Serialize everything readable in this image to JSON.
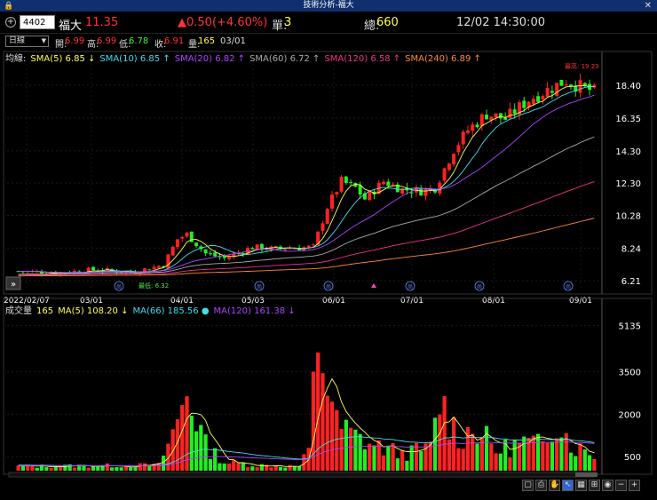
{
  "window": {
    "title": "技術分析-福大"
  },
  "header": {
    "code": "4402",
    "name": "福大",
    "price": "11.35",
    "change": "▲0.50(+4.60%)",
    "unit_label": "單:",
    "unit_value": "3",
    "total_label": "總:",
    "total_value": "660",
    "datetime": "12/02 14:30:00"
  },
  "status": {
    "period": "日線",
    "open_label": "開:",
    "open": "6.99",
    "high_label": "高:",
    "high": "6.99",
    "low_label": "低:",
    "low": "6.78",
    "close_label": "收:",
    "close": "6.91",
    "volume_label": "量:",
    "volume": "165",
    "date": "03/01"
  },
  "ma_legend": {
    "label": "均線:",
    "items": [
      {
        "text": "SMA(5) 6.85 ↓",
        "color": "#ffff55"
      },
      {
        "text": "SMA(10) 6.85 ↑",
        "color": "#44ddee"
      },
      {
        "text": "SMA(20) 6.82 ↑",
        "color": "#aa44ff"
      },
      {
        "text": "SMA(60) 6.72 ↑",
        "color": "#aaaaaa"
      },
      {
        "text": "SMA(120) 6.58 ↑",
        "color": "#ee3388"
      },
      {
        "text": "SMA(240) 6.89 ↑",
        "color": "#ff8833"
      }
    ]
  },
  "vol_legend": {
    "label": "成交量",
    "value": "165",
    "items": [
      {
        "text": "MA(5) 108.20 ↓",
        "color": "#ffff55"
      },
      {
        "text": "MA(66) 185.56 ●",
        "color": "#44ddee"
      },
      {
        "text": "MA(120) 161.38 ↓",
        "color": "#aa44ff"
      }
    ]
  },
  "colors": {
    "up": "#ff2222",
    "down": "#22ee22",
    "axis": "#ffffff"
  },
  "chart_data": [
    {
      "type": "candlestick",
      "title": "",
      "x_ticks": [
        "2022/02/07",
        "03/01",
        "04/01",
        "05/03",
        "06/01",
        "07/01",
        "08/01",
        "09/01"
      ],
      "y_ticks": [
        6.21,
        8.24,
        10.28,
        12.3,
        14.3,
        16.35,
        18.4
      ],
      "ylim": [
        5.6,
        20.0
      ],
      "annotations": [
        {
          "text": "最高: 19.23"
        },
        {
          "text": "最低: 6.32"
        }
      ],
      "event_markers": [
        "尚",
        "尚",
        "尚",
        "尚",
        "尚",
        "尚"
      ],
      "highest": 19.23,
      "lowest": 6.32,
      "waypoints": [
        [
          0,
          6.8
        ],
        [
          8,
          6.7
        ],
        [
          17,
          6.9
        ],
        [
          24,
          6.7
        ],
        [
          31,
          7.2
        ],
        [
          34,
          8.8
        ],
        [
          36,
          9.1
        ],
        [
          40,
          7.9
        ],
        [
          44,
          7.6
        ],
        [
          50,
          8.3
        ],
        [
          54,
          8.2
        ],
        [
          63,
          8.3
        ],
        [
          66,
          10.8
        ],
        [
          69,
          12.4
        ],
        [
          72,
          12.0
        ],
        [
          74,
          11.3
        ],
        [
          78,
          12.4
        ],
        [
          82,
          11.9
        ],
        [
          86,
          11.8
        ],
        [
          89,
          12.0
        ],
        [
          93,
          14.4
        ],
        [
          96,
          15.6
        ],
        [
          100,
          16.6
        ],
        [
          104,
          16.3
        ],
        [
          109,
          17.5
        ],
        [
          113,
          18.1
        ],
        [
          117,
          18.7
        ],
        [
          120,
          18.3
        ],
        [
          123,
          18.0
        ]
      ]
    },
    {
      "type": "bar",
      "title": "",
      "y_ticks": [
        500,
        2000,
        3500,
        5135
      ],
      "ylim": [
        0,
        5500
      ],
      "waypoints": [
        [
          0,
          150
        ],
        [
          30,
          200
        ],
        [
          34,
          1700
        ],
        [
          36,
          2900
        ],
        [
          40,
          900
        ],
        [
          44,
          300
        ],
        [
          50,
          200
        ],
        [
          60,
          150
        ],
        [
          62,
          700
        ],
        [
          64,
          4800
        ],
        [
          66,
          3200
        ],
        [
          68,
          1600
        ],
        [
          72,
          1200
        ],
        [
          76,
          900
        ],
        [
          82,
          600
        ],
        [
          88,
          800
        ],
        [
          90,
          2500
        ],
        [
          94,
          1200
        ],
        [
          98,
          1500
        ],
        [
          102,
          700
        ],
        [
          108,
          1000
        ],
        [
          112,
          900
        ],
        [
          115,
          2000
        ],
        [
          118,
          900
        ],
        [
          123,
          600
        ]
      ]
    }
  ]
}
